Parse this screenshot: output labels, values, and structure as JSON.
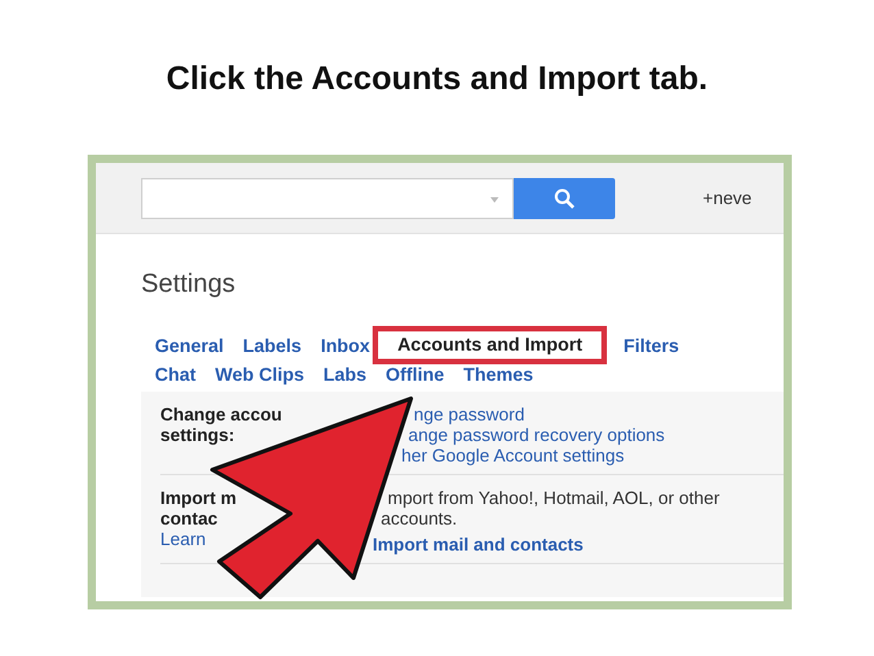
{
  "title": "Click the Accounts and Import tab.",
  "account_link": "+neve",
  "heading": "Settings",
  "tab_rows": [
    [
      {
        "label": "General",
        "selected": false
      },
      {
        "label": "Labels",
        "selected": false
      },
      {
        "label": "Inbox",
        "selected": false
      },
      {
        "label": "Accounts and Import",
        "selected": true
      },
      {
        "label": "Filters",
        "selected": false
      }
    ],
    [
      {
        "label": "Chat",
        "selected": false
      },
      {
        "label": "Web Clips",
        "selected": false
      },
      {
        "label": "Labs",
        "selected": false
      },
      {
        "label": "Offline",
        "selected": false
      },
      {
        "label": "Themes",
        "selected": false
      }
    ]
  ],
  "sections": [
    {
      "label": [
        {
          "kind": "text",
          "text": "Change accou"
        },
        {
          "kind": "text",
          "text": "settings:"
        }
      ],
      "content": [
        {
          "kind": "link",
          "text": "nge password"
        },
        {
          "kind": "link",
          "text": "ange password recovery options"
        },
        {
          "kind": "link",
          "text": "her Google Account settings"
        }
      ]
    },
    {
      "label": [
        {
          "kind": "text",
          "text": "Import m"
        },
        {
          "kind": "text",
          "text": "contac"
        },
        {
          "kind": "link",
          "text": "Learn"
        }
      ],
      "content": [
        {
          "kind": "text",
          "text": "mport from Yahoo!, Hotmail, AOL, or other"
        },
        {
          "kind": "text",
          "text": "accounts."
        },
        {
          "kind": "action",
          "text": "Import mail and contacts"
        }
      ]
    }
  ]
}
